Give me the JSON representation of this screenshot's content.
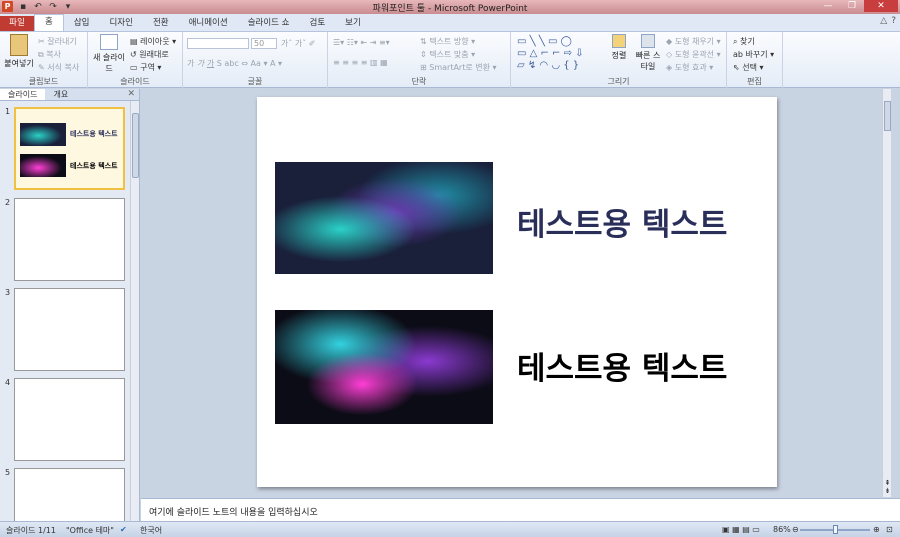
{
  "window": {
    "title": "파워포인트 툴 - Microsoft PowerPoint"
  },
  "tabs": {
    "file": "파일",
    "items": [
      "홈",
      "삽입",
      "디자인",
      "전환",
      "애니메이션",
      "슬라이드 쇼",
      "검토",
      "보기"
    ]
  },
  "ribbon": {
    "clipboard": {
      "name": "클립보드",
      "paste": "붙여넣기",
      "cut": "잘라내기",
      "copy": "복사",
      "format": "서식 복사"
    },
    "slides": {
      "name": "슬라이드",
      "new": "새 슬라이드",
      "layout": "레이아웃",
      "reset": "원래대로",
      "section": "구역"
    },
    "font": {
      "name": "글꼴",
      "size": "50"
    },
    "paragraph": {
      "name": "단락",
      "dir": "텍스트 방향",
      "align": "텍스트 맞춤",
      "smartart": "SmartArt로 변환"
    },
    "drawing": {
      "name": "그리기",
      "arrange": "정렬",
      "quick": "빠른 스타일",
      "fill": "도형 채우기",
      "outline": "도형 윤곽선",
      "effect": "도형 효과"
    },
    "editing": {
      "name": "편집",
      "find": "찾기",
      "replace": "바꾸기",
      "select": "선택"
    }
  },
  "pane": {
    "tab_slides": "슬라이드",
    "tab_outline": "개요",
    "thumb_text": "테스트용 텍스트",
    "slide_numbers": [
      "1",
      "2",
      "3",
      "4",
      "5"
    ]
  },
  "slide": {
    "text1": "테스트용 텍스트",
    "text2": "테스트용 텍스트"
  },
  "notes": {
    "placeholder": "여기에 슬라이드 노트의 내용을 입력하십시오"
  },
  "status": {
    "slide": "슬라이드 1/11",
    "theme": "\"Office 테마\"",
    "lang": "한국어",
    "zoom": "86%"
  }
}
